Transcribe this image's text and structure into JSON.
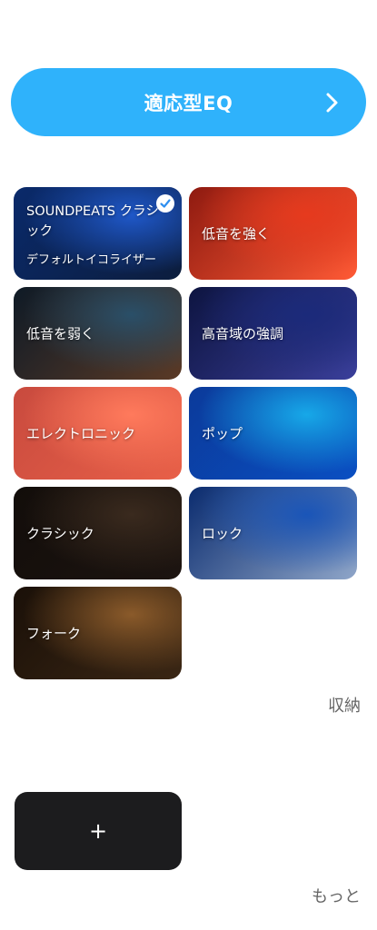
{
  "adaptive_eq": {
    "label": "適応型EQ",
    "chevron_icon": "chevron-right-icon"
  },
  "presets": [
    {
      "id": "soundpeats",
      "title": "SOUNDPEATS クラシック",
      "subtitle": "デフォルトイコライザー",
      "selected": true,
      "colors": [
        "#0a2a6b",
        "#1f58c9",
        "#0c1d3d"
      ]
    },
    {
      "id": "bass-boost",
      "title": "低音を強く",
      "selected": false,
      "colors": [
        "#8e1a10",
        "#e63a1e",
        "#ff5a35"
      ]
    },
    {
      "id": "bass-reduce",
      "title": "低音を弱く",
      "selected": false,
      "colors": [
        "#0e1a26",
        "#2a4f68",
        "#5b3a26"
      ]
    },
    {
      "id": "treble-boost",
      "title": "高音域の強調",
      "selected": false,
      "colors": [
        "#0d1440",
        "#1b2a7a",
        "#3a3f9b"
      ]
    },
    {
      "id": "electronic",
      "title": "エレクトロニック",
      "selected": false,
      "colors": [
        "#c84a3e",
        "#ff7a5c",
        "#e86048"
      ]
    },
    {
      "id": "pop",
      "title": "ポップ",
      "selected": false,
      "colors": [
        "#0b3a9a",
        "#17a8e8",
        "#0a4fc2"
      ]
    },
    {
      "id": "classical",
      "title": "クラシック",
      "selected": false,
      "colors": [
        "#120d0a",
        "#3a2a1e",
        "#1c1410"
      ]
    },
    {
      "id": "rock",
      "title": "ロック",
      "selected": false,
      "colors": [
        "#0a2b6e",
        "#1a55b8",
        "#8fa6c9"
      ]
    },
    {
      "id": "folk",
      "title": "フォーク",
      "selected": false,
      "colors": [
        "#1a1008",
        "#8a5a2a",
        "#3a2614"
      ]
    }
  ],
  "collapse_label": "収納",
  "add_button": {
    "label": "+"
  },
  "more_label": "もっと"
}
